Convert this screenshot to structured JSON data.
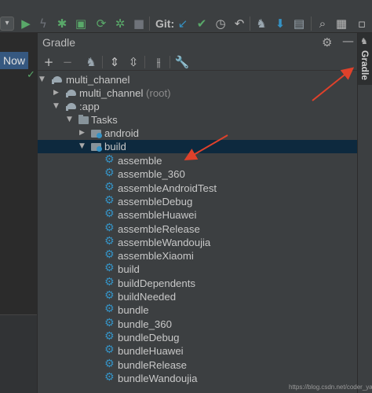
{
  "toolbar": {
    "git_label": "Git:",
    "icons": [
      "run-icon",
      "lightning-icon",
      "debug-icon",
      "coverage-icon",
      "profile-icon",
      "stop-icon",
      "git-update-icon",
      "git-commit-icon",
      "history-icon",
      "rollback-icon",
      "device-manager-icon",
      "sdk-manager-icon",
      "layout-inspector-icon",
      "search-icon",
      "terminal-icon"
    ]
  },
  "left": {
    "now_button": "Now"
  },
  "panel": {
    "title": "Gradle",
    "tools": [
      "add-icon",
      "remove-icon",
      "elephant-icon",
      "expand-all-icon",
      "collapse-all-icon",
      "toggle-offline-icon",
      "wrench-icon"
    ]
  },
  "right_tab": {
    "label": "Gradle"
  },
  "tree": {
    "root": "multi_channel",
    "root_project": "multi_channel",
    "root_suffix": "(root)",
    "app": ":app",
    "tasks": "Tasks",
    "android": "android",
    "build": "build",
    "build_tasks": [
      "assemble",
      "assemble_360",
      "assembleAndroidTest",
      "assembleDebug",
      "assembleHuawei",
      "assembleRelease",
      "assembleWandoujia",
      "assembleXiaomi",
      "build",
      "buildDependents",
      "buildNeeded",
      "bundle",
      "bundle_360",
      "bundleDebug",
      "bundleHuawei",
      "bundleRelease",
      "bundleWandoujia"
    ]
  },
  "watermark": "https://blog.csdn.net/coder_yao",
  "colors": {
    "background": "#3c3f41",
    "selection": "#0d293e",
    "annotation_arrow": "#e0412b",
    "task_gear": "#3592c4",
    "now_button": "#365880"
  }
}
